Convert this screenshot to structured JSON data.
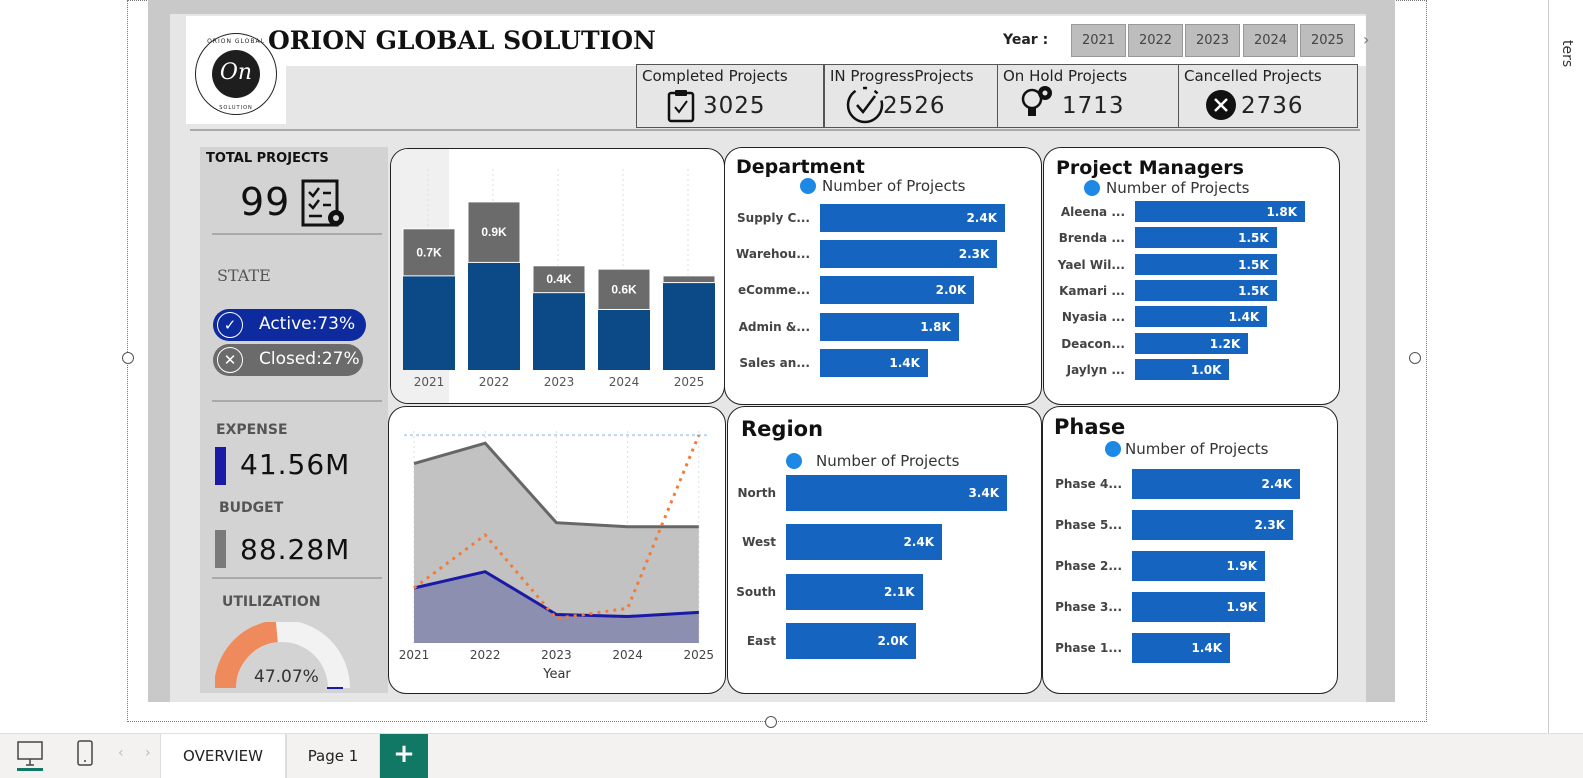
{
  "header": {
    "brand": "ORION GLOBAL SOLUTION",
    "logo_ring_top": "ORION GLOBAL",
    "logo_initials": "On",
    "logo_ring_bottom": "SOLUTION",
    "year_label": "Year :",
    "years": [
      "2021",
      "2022",
      "2023",
      "2024",
      "2025"
    ]
  },
  "kpis": {
    "completed_title": "Completed Projects",
    "completed_value": "3025",
    "inprogress_title": "IN ProgressProjects",
    "inprogress_value": "2526",
    "onhold_title": "On Hold Projects",
    "onhold_value": "1713",
    "cancelled_title": "Cancelled Projects",
    "cancelled_value": "2736"
  },
  "left": {
    "total_label": "TOTAL PROJECTS",
    "total_value": "99",
    "state_label": "STATE",
    "active_label": "Active:73%",
    "closed_label": "Closed:27%",
    "expense_label": "EXPENSE",
    "expense_value": "41.56M",
    "budget_label": "BUDGET",
    "budget_value": "88.28M",
    "utilization_label": "UTILIZATION",
    "utilization_value": "47.07%",
    "utilization_fraction": 0.4707,
    "colors": {
      "expense": "#1a1aa6",
      "budget": "#7a7a7a",
      "gauge": "#ee8a5c",
      "active": "#0d2a9e",
      "closed": "#6b6b6b"
    }
  },
  "chart_data": [
    {
      "type": "bar",
      "stacked": true,
      "categories": [
        "2021",
        "2022",
        "2023",
        "2024",
        "2025"
      ],
      "series": [
        {
          "values": [
            1.4,
            1.6,
            1.15,
            0.9,
            1.3
          ],
          "color": "#0b4a86"
        },
        {
          "values": [
            0.7,
            0.9,
            0.4,
            0.6,
            0.1
          ],
          "color": "#6b6b6b"
        }
      ],
      "data_labels": [
        "0.7K",
        "0.9K",
        "0.4K",
        "0.6K",
        ""
      ],
      "ylim": [
        0,
        2.9
      ],
      "highlight": "2021"
    },
    {
      "type": "area",
      "x": [
        "2021",
        "2022",
        "2023",
        "2024",
        "2025"
      ],
      "xlabel": "Year",
      "series": [
        {
          "values": [
            88,
            98,
            59,
            57,
            57
          ],
          "color": "#666666",
          "style": "area"
        },
        {
          "values": [
            27,
            35,
            14,
            13,
            15
          ],
          "color": "#1a1aa6",
          "style": "area"
        },
        {
          "values": [
            27,
            53,
            12,
            17,
            102
          ],
          "color": "#f07c3a",
          "style": "dotted"
        }
      ],
      "reference_line": 102,
      "ylim": [
        0,
        104
      ]
    },
    {
      "type": "bar",
      "orientation": "horizontal",
      "title": "Department",
      "legend": "Number of Projects",
      "categories": [
        "Supply C...",
        "Warehou...",
        "eComme...",
        "Admin &...",
        "Sales an..."
      ],
      "values": [
        2.4,
        2.3,
        2.0,
        1.8,
        1.4
      ],
      "labels": [
        "2.4K",
        "2.3K",
        "2.0K",
        "1.8K",
        "1.4K"
      ],
      "xlim": [
        0,
        2.4
      ]
    },
    {
      "type": "bar",
      "orientation": "horizontal",
      "title": "Project Managers",
      "legend": "Number of Projects",
      "categories": [
        "Aleena ...",
        "Brenda ...",
        "Yael Wil...",
        "Kamari ...",
        "Nyasia ...",
        "Deacon...",
        "Jaylyn ..."
      ],
      "values": [
        1.8,
        1.5,
        1.5,
        1.5,
        1.4,
        1.2,
        1.0
      ],
      "labels": [
        "1.8K",
        "1.5K",
        "1.5K",
        "1.5K",
        "1.4K",
        "1.2K",
        "1.0K"
      ],
      "xlim": [
        0,
        1.8
      ]
    },
    {
      "type": "bar",
      "orientation": "horizontal",
      "title": "Region",
      "legend": "Number of Projects",
      "categories": [
        "North",
        "West",
        "South",
        "East"
      ],
      "values": [
        3.4,
        2.4,
        2.1,
        2.0
      ],
      "labels": [
        "3.4K",
        "2.4K",
        "2.1K",
        "2.0K"
      ],
      "xlim": [
        0,
        3.4
      ]
    },
    {
      "type": "bar",
      "orientation": "horizontal",
      "title": "Phase",
      "legend": "Number of Projects",
      "categories": [
        "Phase 4...",
        "Phase 5...",
        "Phase 2...",
        "Phase 3...",
        "Phase 1..."
      ],
      "values": [
        2.4,
        2.3,
        1.9,
        1.9,
        1.4
      ],
      "labels": [
        "2.4K",
        "2.3K",
        "1.9K",
        "1.9K",
        "1.4K"
      ],
      "xlim": [
        0,
        2.4
      ]
    }
  ],
  "footer": {
    "tabs": [
      "OVERVIEW",
      "Page 1"
    ],
    "add_tab": "+"
  },
  "side": {
    "label": "ters"
  }
}
